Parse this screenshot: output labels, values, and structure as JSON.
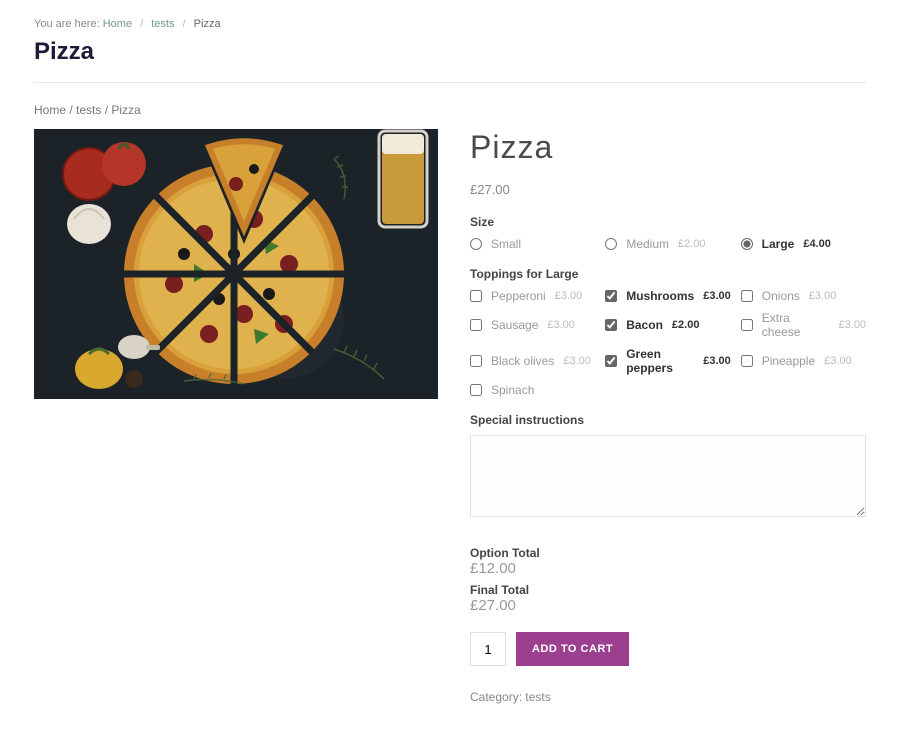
{
  "top_breadcrumb": {
    "prefix": "You are here:",
    "home": "Home",
    "mid": "tests",
    "current": "Pizza"
  },
  "page_title": "Pizza",
  "wc_breadcrumb": "Home / tests / Pizza",
  "product": {
    "title": "Pizza",
    "price": "£27.00",
    "size_label": "Size",
    "sizes": [
      {
        "name": "Small",
        "price": "",
        "selected": false
      },
      {
        "name": "Medium",
        "price": "£2.00",
        "selected": false
      },
      {
        "name": "Large",
        "price": "£4.00",
        "selected": true
      }
    ],
    "toppings_label": "Toppings for Large",
    "toppings": [
      {
        "name": "Pepperoni",
        "price": "£3.00",
        "selected": false
      },
      {
        "name": "Mushrooms",
        "price": "£3.00",
        "selected": true
      },
      {
        "name": "Onions",
        "price": "£3.00",
        "selected": false
      },
      {
        "name": "Sausage",
        "price": "£3.00",
        "selected": false
      },
      {
        "name": "Bacon",
        "price": "£2.00",
        "selected": true
      },
      {
        "name": "Extra cheese",
        "price": "£3.00",
        "selected": false
      },
      {
        "name": "Black olives",
        "price": "£3.00",
        "selected": false
      },
      {
        "name": "Green peppers",
        "price": "£3.00",
        "selected": true
      },
      {
        "name": "Pineapple",
        "price": "£3.00",
        "selected": false
      },
      {
        "name": "Spinach",
        "price": "",
        "selected": false
      }
    ],
    "instructions_label": "Special instructions",
    "instructions_value": "",
    "option_total_label": "Option Total",
    "option_total_value": "£12.00",
    "final_total_label": "Final Total",
    "final_total_value": "£27.00",
    "quantity": "1",
    "add_to_cart": "ADD TO CART",
    "category_label": "Category:",
    "category_value": "tests"
  }
}
